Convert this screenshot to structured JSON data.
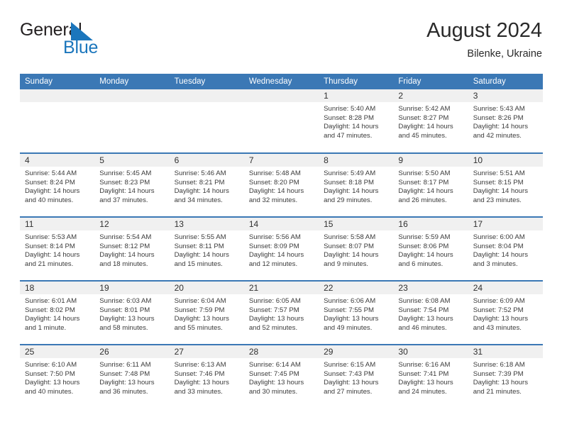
{
  "brand": {
    "name_part1": "General",
    "name_part2": "Blue",
    "triangle_color": "#1b76bc"
  },
  "header": {
    "title": "August 2024",
    "location": "Bilenke, Ukraine",
    "accent_color": "#3b78b5",
    "daynum_band_color": "#f0f0f0"
  },
  "weekdays": [
    "Sunday",
    "Monday",
    "Tuesday",
    "Wednesday",
    "Thursday",
    "Friday",
    "Saturday"
  ],
  "weeks": [
    [
      {
        "day": "",
        "info": ""
      },
      {
        "day": "",
        "info": ""
      },
      {
        "day": "",
        "info": ""
      },
      {
        "day": "",
        "info": ""
      },
      {
        "day": "1",
        "info": "Sunrise: 5:40 AM\nSunset: 8:28 PM\nDaylight: 14 hours\nand 47 minutes."
      },
      {
        "day": "2",
        "info": "Sunrise: 5:42 AM\nSunset: 8:27 PM\nDaylight: 14 hours\nand 45 minutes."
      },
      {
        "day": "3",
        "info": "Sunrise: 5:43 AM\nSunset: 8:26 PM\nDaylight: 14 hours\nand 42 minutes."
      }
    ],
    [
      {
        "day": "4",
        "info": "Sunrise: 5:44 AM\nSunset: 8:24 PM\nDaylight: 14 hours\nand 40 minutes."
      },
      {
        "day": "5",
        "info": "Sunrise: 5:45 AM\nSunset: 8:23 PM\nDaylight: 14 hours\nand 37 minutes."
      },
      {
        "day": "6",
        "info": "Sunrise: 5:46 AM\nSunset: 8:21 PM\nDaylight: 14 hours\nand 34 minutes."
      },
      {
        "day": "7",
        "info": "Sunrise: 5:48 AM\nSunset: 8:20 PM\nDaylight: 14 hours\nand 32 minutes."
      },
      {
        "day": "8",
        "info": "Sunrise: 5:49 AM\nSunset: 8:18 PM\nDaylight: 14 hours\nand 29 minutes."
      },
      {
        "day": "9",
        "info": "Sunrise: 5:50 AM\nSunset: 8:17 PM\nDaylight: 14 hours\nand 26 minutes."
      },
      {
        "day": "10",
        "info": "Sunrise: 5:51 AM\nSunset: 8:15 PM\nDaylight: 14 hours\nand 23 minutes."
      }
    ],
    [
      {
        "day": "11",
        "info": "Sunrise: 5:53 AM\nSunset: 8:14 PM\nDaylight: 14 hours\nand 21 minutes."
      },
      {
        "day": "12",
        "info": "Sunrise: 5:54 AM\nSunset: 8:12 PM\nDaylight: 14 hours\nand 18 minutes."
      },
      {
        "day": "13",
        "info": "Sunrise: 5:55 AM\nSunset: 8:11 PM\nDaylight: 14 hours\nand 15 minutes."
      },
      {
        "day": "14",
        "info": "Sunrise: 5:56 AM\nSunset: 8:09 PM\nDaylight: 14 hours\nand 12 minutes."
      },
      {
        "day": "15",
        "info": "Sunrise: 5:58 AM\nSunset: 8:07 PM\nDaylight: 14 hours\nand 9 minutes."
      },
      {
        "day": "16",
        "info": "Sunrise: 5:59 AM\nSunset: 8:06 PM\nDaylight: 14 hours\nand 6 minutes."
      },
      {
        "day": "17",
        "info": "Sunrise: 6:00 AM\nSunset: 8:04 PM\nDaylight: 14 hours\nand 3 minutes."
      }
    ],
    [
      {
        "day": "18",
        "info": "Sunrise: 6:01 AM\nSunset: 8:02 PM\nDaylight: 14 hours\nand 1 minute."
      },
      {
        "day": "19",
        "info": "Sunrise: 6:03 AM\nSunset: 8:01 PM\nDaylight: 13 hours\nand 58 minutes."
      },
      {
        "day": "20",
        "info": "Sunrise: 6:04 AM\nSunset: 7:59 PM\nDaylight: 13 hours\nand 55 minutes."
      },
      {
        "day": "21",
        "info": "Sunrise: 6:05 AM\nSunset: 7:57 PM\nDaylight: 13 hours\nand 52 minutes."
      },
      {
        "day": "22",
        "info": "Sunrise: 6:06 AM\nSunset: 7:55 PM\nDaylight: 13 hours\nand 49 minutes."
      },
      {
        "day": "23",
        "info": "Sunrise: 6:08 AM\nSunset: 7:54 PM\nDaylight: 13 hours\nand 46 minutes."
      },
      {
        "day": "24",
        "info": "Sunrise: 6:09 AM\nSunset: 7:52 PM\nDaylight: 13 hours\nand 43 minutes."
      }
    ],
    [
      {
        "day": "25",
        "info": "Sunrise: 6:10 AM\nSunset: 7:50 PM\nDaylight: 13 hours\nand 40 minutes."
      },
      {
        "day": "26",
        "info": "Sunrise: 6:11 AM\nSunset: 7:48 PM\nDaylight: 13 hours\nand 36 minutes."
      },
      {
        "day": "27",
        "info": "Sunrise: 6:13 AM\nSunset: 7:46 PM\nDaylight: 13 hours\nand 33 minutes."
      },
      {
        "day": "28",
        "info": "Sunrise: 6:14 AM\nSunset: 7:45 PM\nDaylight: 13 hours\nand 30 minutes."
      },
      {
        "day": "29",
        "info": "Sunrise: 6:15 AM\nSunset: 7:43 PM\nDaylight: 13 hours\nand 27 minutes."
      },
      {
        "day": "30",
        "info": "Sunrise: 6:16 AM\nSunset: 7:41 PM\nDaylight: 13 hours\nand 24 minutes."
      },
      {
        "day": "31",
        "info": "Sunrise: 6:18 AM\nSunset: 7:39 PM\nDaylight: 13 hours\nand 21 minutes."
      }
    ]
  ]
}
